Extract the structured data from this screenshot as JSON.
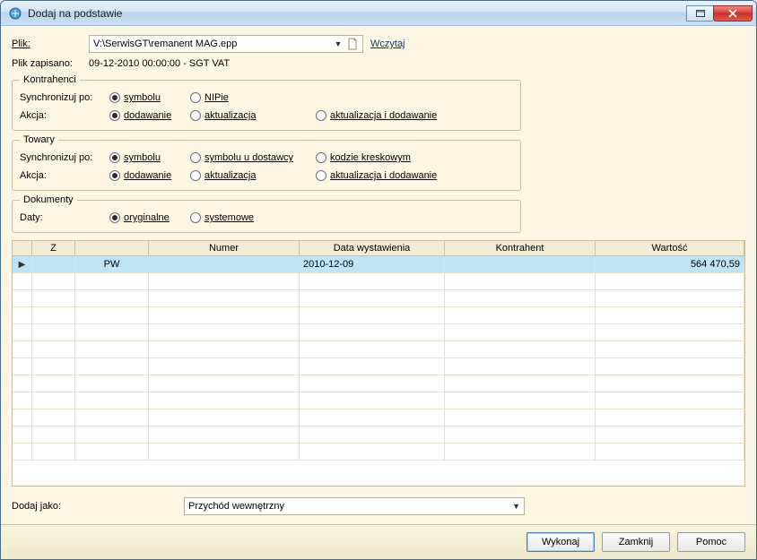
{
  "window": {
    "title": "Dodaj na podstawie"
  },
  "file": {
    "label": "Plik:",
    "path": "V:\\SerwisGT\\remanent MAG.epp",
    "link": "Wczytaj",
    "saved_label": "Plik zapisano:",
    "saved_value": "09-12-2010 00:00:00 - SGT VAT"
  },
  "groups": {
    "kontrahenci": {
      "legend": "Kontrahenci",
      "sync_label": "Synchronizuj po:",
      "action_label": "Akcja:",
      "sync_opts": {
        "symbolu": "symbolu",
        "nipie": "NIPie"
      },
      "action_opts": {
        "dodawanie": "dodawanie",
        "aktualizacja": "aktualizacja",
        "aktidod": "aktualizacja i dodawanie"
      }
    },
    "towary": {
      "legend": "Towary",
      "sync_label": "Synchronizuj po:",
      "action_label": "Akcja:",
      "sync_opts": {
        "symbolu": "symbolu",
        "symbdost": "symbolu u dostawcy",
        "kodzie": "kodzie kreskowym"
      },
      "action_opts": {
        "dodawanie": "dodawanie",
        "aktualizacja": "aktualizacja",
        "aktidod": "aktualizacja i dodawanie"
      }
    },
    "dokumenty": {
      "legend": "Dokumenty",
      "daty_label": "Daty:",
      "opts": {
        "oryginalne": "oryginalne",
        "systemowe": "systemowe"
      }
    }
  },
  "grid": {
    "headers": {
      "z": "Z",
      "sort": "",
      "typ": "",
      "numer": "Numer",
      "data": "Data wystawienia",
      "kontrahent": "Kontrahent",
      "wartosc": "Wartość"
    },
    "rows": [
      {
        "mark": "▶",
        "z": "",
        "typ": "PW",
        "numer": "",
        "data": "2010-12-09",
        "kontrahent": "",
        "wartosc": "564 470,59"
      }
    ]
  },
  "dodajjako": {
    "label": "Dodaj jako:",
    "value": "Przychód wewnętrzny"
  },
  "buttons": {
    "wykonaj": "Wykonaj",
    "zamknij": "Zamknij",
    "pomoc": "Pomoc"
  }
}
